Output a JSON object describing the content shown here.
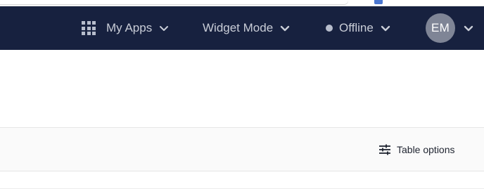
{
  "theme": {
    "header_bg": "#17213f",
    "avatar_bg": "#7f8596",
    "status_offline_color": "#b7bdcc"
  },
  "header": {
    "my_apps": {
      "label": "My Apps",
      "icon": "apps-grid-icon"
    },
    "widget_mode": {
      "label": "Widget Mode"
    },
    "status": {
      "label": "Offline"
    },
    "user": {
      "initials": "EM"
    }
  },
  "toolbar": {
    "table_options_label": "Table options",
    "table_options_icon": "sliders-icon"
  }
}
